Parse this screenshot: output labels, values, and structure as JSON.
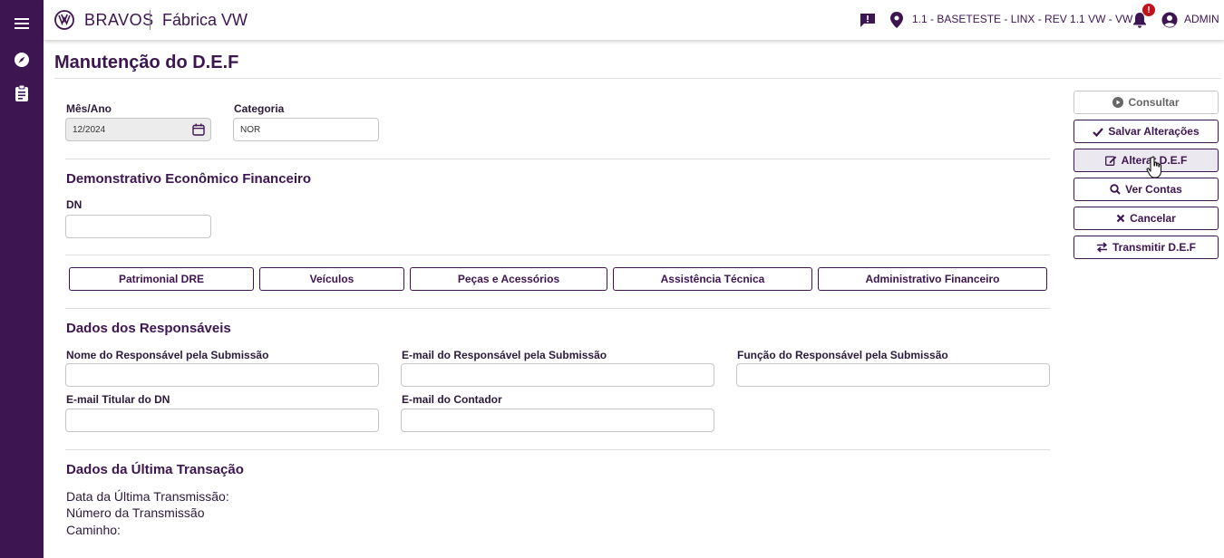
{
  "app": {
    "brand": "BRAVOS",
    "subtitle": "Fábrica VW",
    "location": "1.1 - BASETESTE - LINX - REV 1.1 VW - VW",
    "notification_count": "!",
    "user": "ADMIN"
  },
  "sidebar": {
    "items": [
      {
        "icon": "menu-icon"
      },
      {
        "icon": "compass-icon"
      },
      {
        "icon": "clipboard-icon"
      }
    ]
  },
  "page": {
    "title": "Manutenção do D.E.F"
  },
  "filters": {
    "mes_ano_label": "Mês/Ano",
    "mes_ano_value": "12/2024",
    "categoria_label": "Categoria",
    "categoria_value": "NOR"
  },
  "def_section": {
    "title": "Demonstrativo Econômico Financeiro",
    "dn_label": "DN",
    "dn_value": ""
  },
  "tabs": [
    {
      "label": "Patrimonial DRE"
    },
    {
      "label": "Veículos"
    },
    {
      "label": "Peças e Acessórios"
    },
    {
      "label": "Assistência Técnica"
    },
    {
      "label": "Administrativo Financeiro"
    }
  ],
  "responsaveis": {
    "title": "Dados dos Responsáveis",
    "nome_label": "Nome do Responsável pela Submissão",
    "email_resp_label": "E-mail do Responsável pela Submissão",
    "funcao_label": "Função do Responsável pela Submissão",
    "email_titular_label": "E-mail Titular do DN",
    "email_contador_label": "E-mail do Contador"
  },
  "ultima_transacao": {
    "title": "Dados da Última Transação",
    "data_label": "Data da Última Transmissão:",
    "numero_label": "Número da Transmissão",
    "caminho_label": "Caminho:"
  },
  "actions": [
    {
      "label": "Consultar",
      "icon": "play-circle-icon",
      "state": "disabled"
    },
    {
      "label": "Salvar Alterações",
      "icon": "check-icon",
      "state": "normal"
    },
    {
      "label": "Alterar D.E.F",
      "icon": "edit-icon",
      "state": "hover"
    },
    {
      "label": "Ver Contas",
      "icon": "search-icon",
      "state": "normal"
    },
    {
      "label": "Cancelar",
      "icon": "close-icon",
      "state": "normal"
    },
    {
      "label": "Transmitir D.E.F",
      "icon": "exchange-icon",
      "state": "normal"
    }
  ],
  "colors": {
    "brand": "#3d1550",
    "badge": "#c0121b",
    "divider": "#dddddd"
  }
}
